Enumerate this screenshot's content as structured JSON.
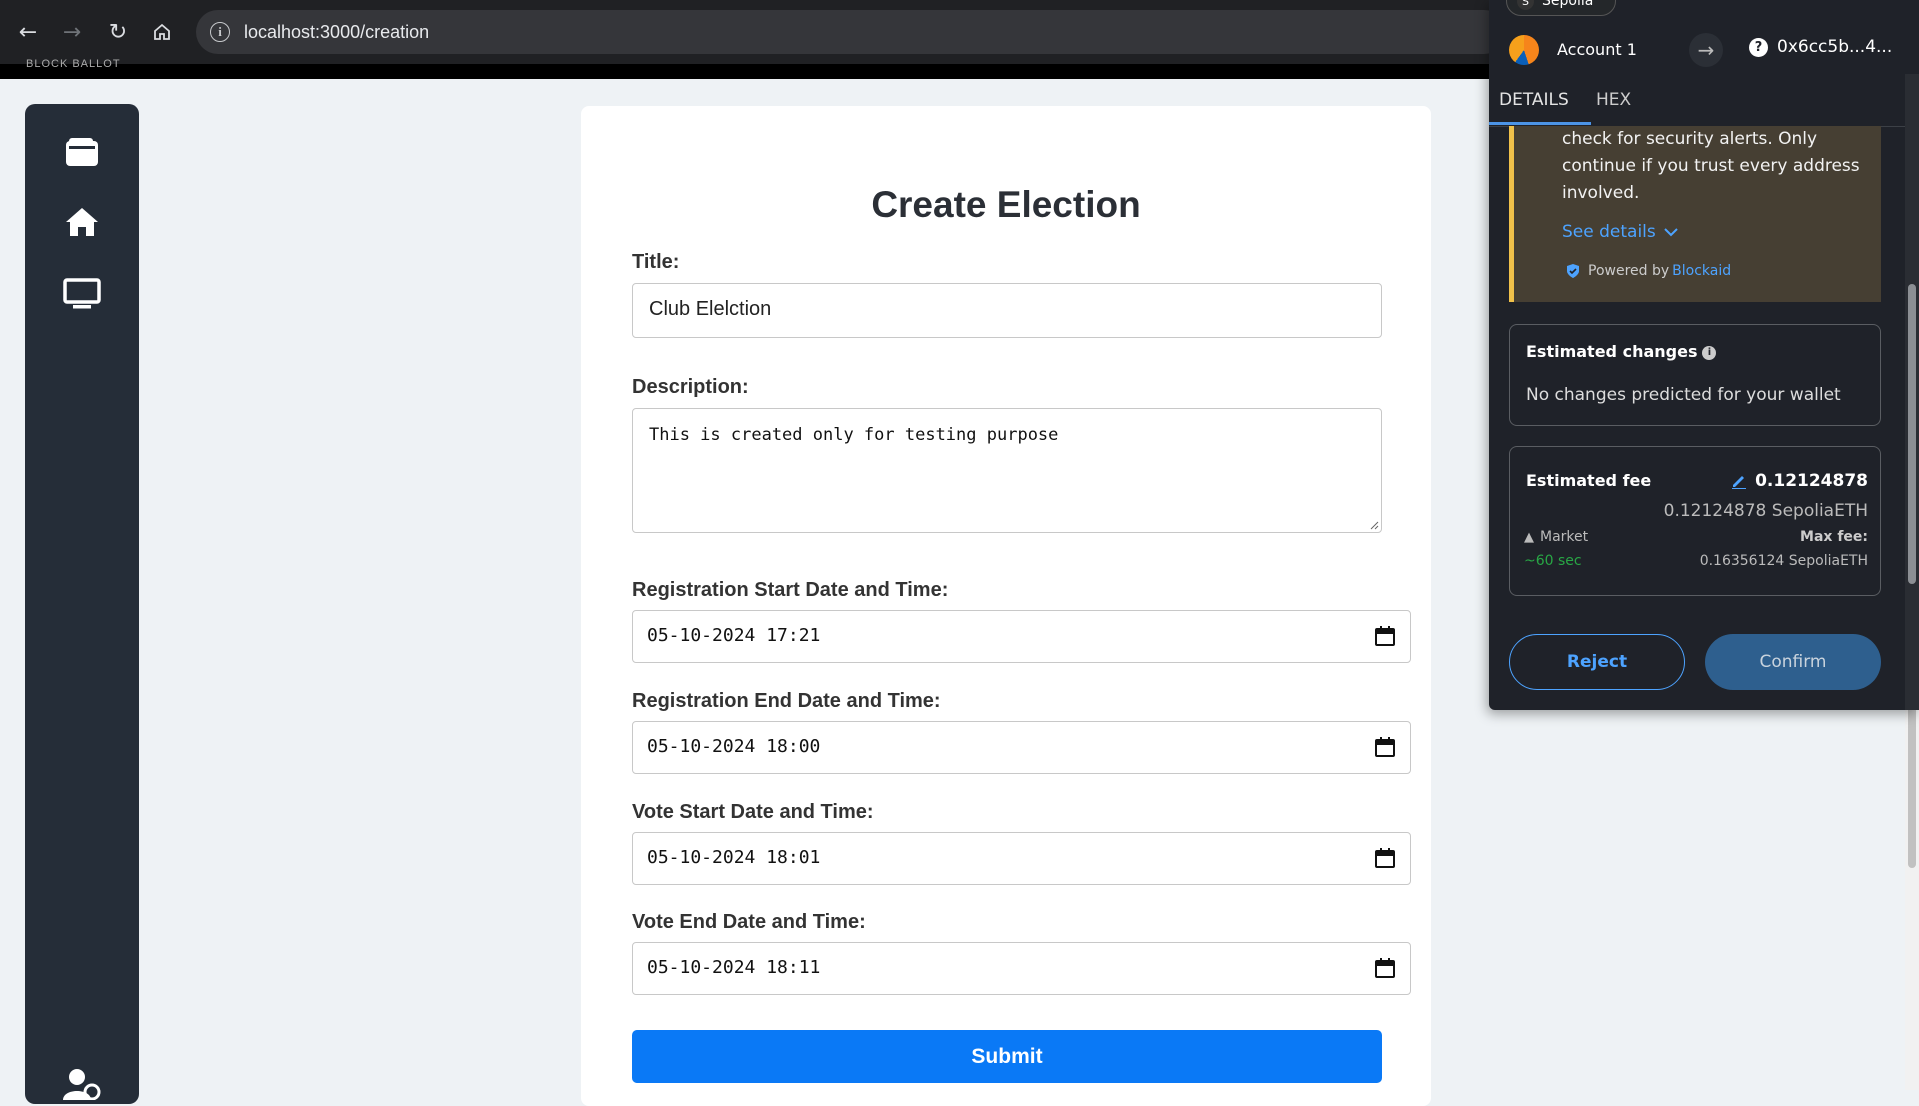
{
  "browser": {
    "back_icon": "arrow-left",
    "forward_icon": "arrow-right",
    "reload_icon": "reload",
    "home_icon": "home",
    "url": "localhost:3000/creation"
  },
  "app": {
    "brand": "BLOCK BALLOT",
    "sidebar_icons": [
      "wallet-icon",
      "home-icon",
      "monitor-icon",
      "user-settings-icon"
    ]
  },
  "form": {
    "title": "Create Election",
    "title_label": "Title:",
    "title_value": "Club Elelction",
    "description_label": "Description:",
    "description_value": "This is created only for testing purpose",
    "reg_start_label": "Registration Start Date and Time:",
    "reg_start_value": "05-10-2024 17:21",
    "reg_end_label": "Registration End Date and Time:",
    "reg_end_value": "05-10-2024 18:00",
    "vote_start_label": "Vote Start Date and Time:",
    "vote_start_value": "05-10-2024 18:01",
    "vote_end_label": "Vote End Date and Time:",
    "vote_end_value": "05-10-2024 18:11",
    "submit_label": "Submit",
    "accent": "#0a79f6"
  },
  "wallet": {
    "network_initial": "S",
    "network": "Sepolia",
    "account_name": "Account 1",
    "address": "0x6cc5b...4...",
    "tabs": [
      "DETAILS",
      "HEX"
    ],
    "alert_text": "check for security alerts. Only continue if you trust every address involved.",
    "see_details": "See details",
    "powered_by": "Powered by",
    "powered_link": "Blockaid",
    "est_changes_title": "Estimated changes",
    "est_changes_text": "No changes predicted for your wallet",
    "est_fee_title": "Estimated fee",
    "est_fee_value": "0.12124878",
    "est_fee_eth": "0.12124878 SepoliaETH",
    "market_label": "Market",
    "max_fee_label": "Max fee:",
    "time_label": "~60 sec",
    "max_fee_value": "0.16356124 SepoliaETH",
    "reject_label": "Reject",
    "confirm_label": "Confirm"
  }
}
